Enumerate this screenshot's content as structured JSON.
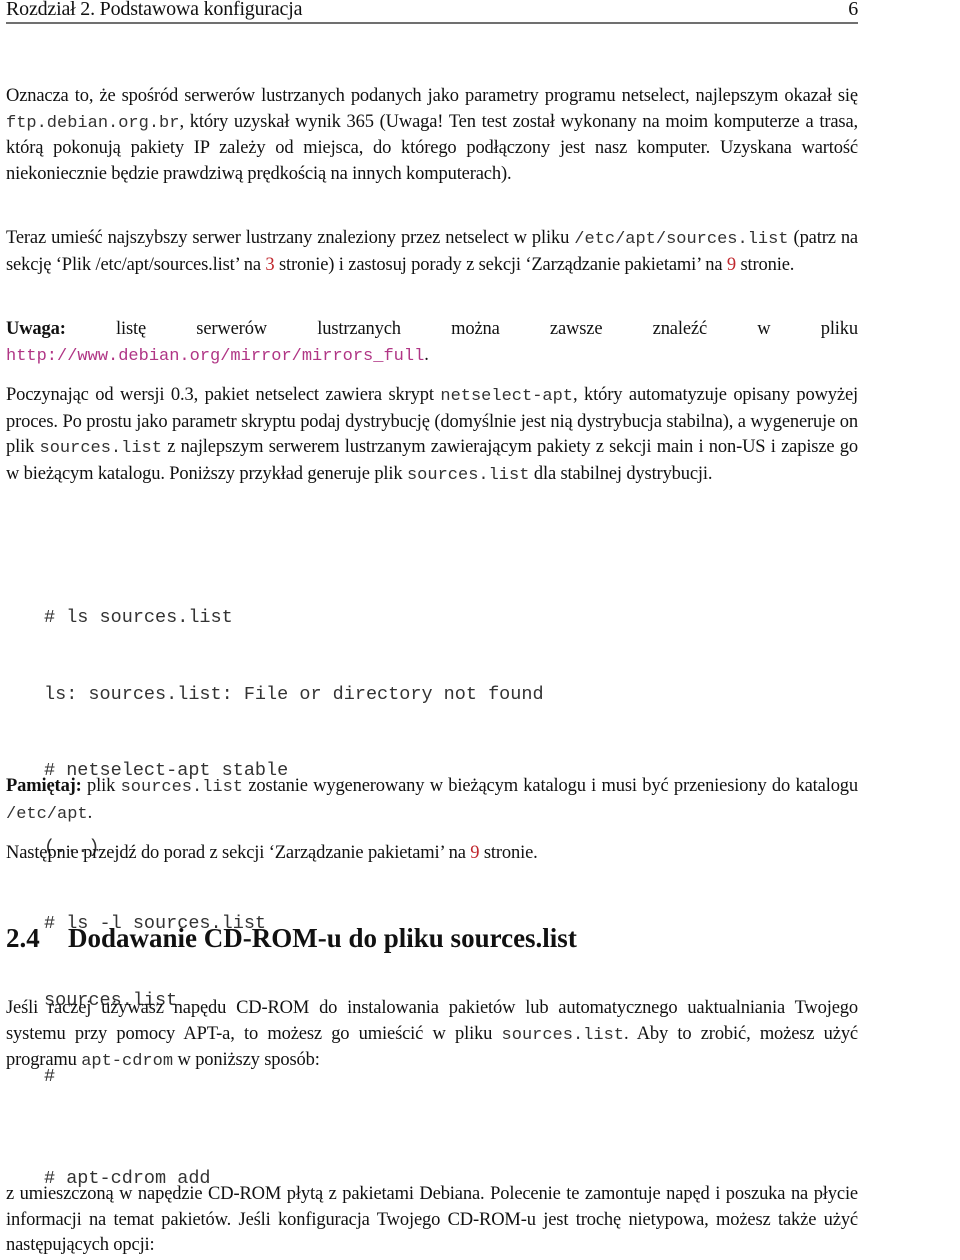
{
  "header": {
    "title": "Rozdział 2. Podstawowa konfiguracja",
    "page_number": "6"
  },
  "p1": {
    "t1": "Oznacza to, że spośród serwerów lustrzanych podanych jako parametry programu netselect, najlepszym okazał się ",
    "code1": "ftp.debian.org.br",
    "t2": ", który uzyskał wynik 365 (Uwaga! Ten test został wykonany na moim komputerze a trasa, którą pokonują pakiety IP zależy od miejsca, do którego podłączony jest nasz komputer.  Uzyskana wartość niekoniecznie będzie prawdziwą prędkością na innych komputerach)."
  },
  "p2": {
    "t1": "Teraz umieść najszybszy serwer lustrzany znaleziony przez netselect w pliku ",
    "code1": "/etc/apt/sources.list",
    "t2": " (patrz na sekcję ‘Plik /etc/apt/sources.list’ na ",
    "ref1": "3",
    "t3": " stronie) i zastosuj porady z sekcji ‘Zarządzanie pakietami’ na ",
    "ref2": "9",
    "t4": " stronie."
  },
  "p3": {
    "bold": "Uwaga:",
    "t1": " listę serwerów lustrzanych można zawsze znaleźć w pliku ",
    "url": "http://www.debian.org/mirror/mirrors_full",
    "t2": "."
  },
  "p4": {
    "t1": "Poczynając od wersji 0.3, pakiet netselect zawiera skrypt ",
    "code1": "netselect-apt",
    "t2": ", który automatyzuje opisany powyżej proces.  Po prostu jako parametr skryptu podaj dystrybucję (domyślnie jest nią dystrybucja stabilna), a wygeneruje on plik ",
    "code2": "sources.list",
    "t3": " z najlepszym serwerem lustrzanym zawierającym pakiety z sekcji main i non-US i zapisze go w bieżącym katalogu. Poniższy przykład generuje plik ",
    "code3": "sources.list",
    "t4": " dla stabilnej dystrybucji."
  },
  "code_block_1": {
    "lines": [
      "# ls sources.list",
      "ls: sources.list: File or directory not found",
      "# netselect-apt stable",
      "(...)",
      "# ls -l sources.list",
      "sources.list",
      "#"
    ]
  },
  "p5": {
    "bold": "Pamiętaj:",
    "t1": " plik ",
    "code1": "sources.list",
    "t2": " zostanie wygenerowany w bieżącym katalogu i musi być przeniesiony do katalogu ",
    "code2": "/etc/apt",
    "t3": "."
  },
  "p6": {
    "t1": "Następnie przejdź do porad z sekcji ‘Zarządzanie pakietami’ na ",
    "ref1": "9",
    "t2": " stronie."
  },
  "section": {
    "number": "2.4",
    "title": "Dodawanie CD-ROM-u do pliku sources.list"
  },
  "p7": {
    "t1": "Jeśli raczej używasz napędu CD-ROM do instalowania pakietów lub automatycznego uaktualniania Twojego systemu przy pomocy APT-a, to możesz go umieścić w pliku ",
    "code1": "sources.list",
    "t2": ". Aby to zrobić, możesz użyć programu ",
    "code2": "apt-cdrom",
    "t3": " w poniższy sposób:"
  },
  "code_block_2": {
    "lines": [
      "# apt-cdrom add"
    ]
  },
  "p8": {
    "t1": "z umieszczoną w napędzie CD-ROM płytą z pakietami Debiana. Polecenie te zamontuje napęd i poszuka na płycie informacji na temat pakietów.  Jeśli konfiguracja Twojego CD-ROM-u jest trochę nietypowa, możesz także użyć następujących opcji:"
  },
  "colors": {
    "link_url": "#b03585",
    "page_ref": "#c0272d",
    "header_rule": "#707070"
  }
}
